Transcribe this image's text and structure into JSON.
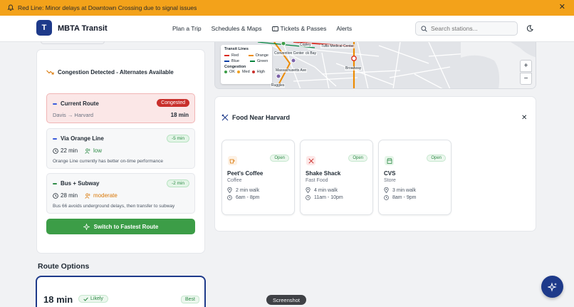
{
  "alert": {
    "text": "Red Line: Minor delays at Downtown Crossing due to signal issues"
  },
  "header": {
    "logo_letter": "T",
    "brand": "MBTA Transit",
    "nav": [
      "Plan a Trip",
      "Schedules & Maps",
      "Tickets & Passes",
      "Alerts"
    ],
    "search_placeholder": "Search stations..."
  },
  "congestion": {
    "title": "Congestion Detected - Alternates Available",
    "current": {
      "label": "Current Route",
      "badge": "Congested",
      "path": "Davis → Harvard",
      "time": "18 min"
    },
    "orange": {
      "label": "Via Orange Line",
      "badge": "-5 min",
      "time": "22 min",
      "crowd": "low",
      "note": "Orange Line currently has better on-time performance"
    },
    "bus": {
      "label": "Bus + Subway",
      "badge": "-2 min",
      "time": "28 min",
      "crowd": "moderate",
      "note": "Bus 66 avoids underground delays, then transfer to subway"
    },
    "switch_label": "Switch to Fastest Route"
  },
  "route_options": {
    "title": "Route Options",
    "first": {
      "time": "18 min",
      "badge": "Likely",
      "tag": "Best"
    }
  },
  "map": {
    "legend_title": "Transit Lines",
    "lines": {
      "red": "Red",
      "orange": "Orange",
      "blue": "Blue",
      "green": "Green"
    },
    "congestion_title": "Congestion",
    "congestion_levels": {
      "ok": "OK",
      "med": "Med",
      "high": "High"
    },
    "labels": {
      "copley": "Copley",
      "tufts": "Tufts Medical Center",
      "convention": "Convention Center",
      "back_bay": "ck Bay",
      "mass_ave": "Massachusetts Ave",
      "broadway": "Broadway",
      "ruggles": "Ruggles"
    },
    "zoom_in": "+",
    "zoom_out": "−"
  },
  "food": {
    "title": "Food Near Harvard",
    "places": [
      {
        "name": "Peet's Coffee",
        "category": "Coffee",
        "walk": "2 min walk",
        "hours": "6am - 8pm",
        "status": "Open"
      },
      {
        "name": "Shake Shack",
        "category": "Fast Food",
        "walk": "4 min walk",
        "hours": "11am - 10pm",
        "status": "Open"
      },
      {
        "name": "CVS",
        "category": "Store",
        "walk": "3 min walk",
        "hours": "8am - 9pm",
        "status": "Open"
      }
    ]
  },
  "tooltip": "Screenshot",
  "colors": {
    "alert": "#f3a21a",
    "brand": "#1e3a8a",
    "congested": "#c9302c",
    "success": "#3c9d47",
    "red_line": "#da291c",
    "orange_line": "#ed8b00",
    "blue_line": "#003da5",
    "green_line": "#00843d"
  }
}
